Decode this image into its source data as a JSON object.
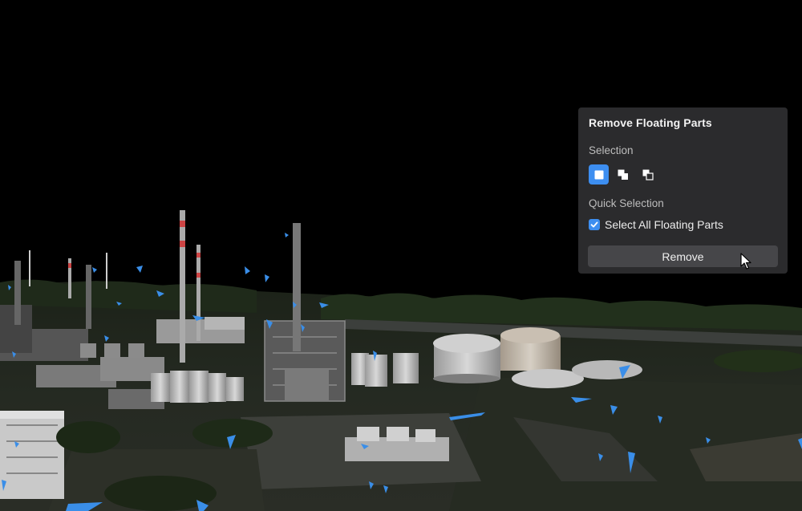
{
  "panel": {
    "title": "Remove Floating Parts",
    "selection_label": "Selection",
    "selection_modes": [
      {
        "name": "new-selection",
        "icon": "square-selection-icon",
        "active": true
      },
      {
        "name": "add-selection",
        "icon": "add-selection-icon",
        "active": false
      },
      {
        "name": "subtract-selection",
        "icon": "subtract-selection-icon",
        "active": false
      }
    ],
    "quick_selection_label": "Quick Selection",
    "select_all_label": "Select All Floating Parts",
    "select_all_checked": true,
    "remove_label": "Remove"
  },
  "colors": {
    "panel_bg": "#2b2b2d",
    "accent": "#3d8ef0",
    "button_bg": "#464649",
    "floating_parts": "#3a8ee8",
    "background": "#000000"
  },
  "scene": {
    "description_icon": "industrial-plant-3d-model"
  }
}
